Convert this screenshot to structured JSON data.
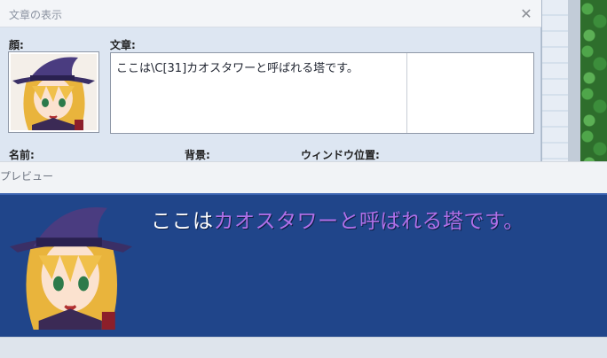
{
  "dialog": {
    "title": "文章の表示",
    "close_glyph": "✕",
    "face_label": "顔:",
    "text_label": "文章:",
    "message_raw": "ここは\\C[31]カオスタワーと呼ばれる塔です。",
    "name_label": "名前:",
    "background_label": "背景:",
    "window_position_label": "ウィンドウ位置:"
  },
  "preview": {
    "label": "プレビュー",
    "text_normal": "ここは",
    "text_colored": "カオスタワーと呼ばれる塔です。",
    "colored_text_color": "#b070e8"
  },
  "icons": {
    "close": "close-icon",
    "face": "character-portrait"
  }
}
